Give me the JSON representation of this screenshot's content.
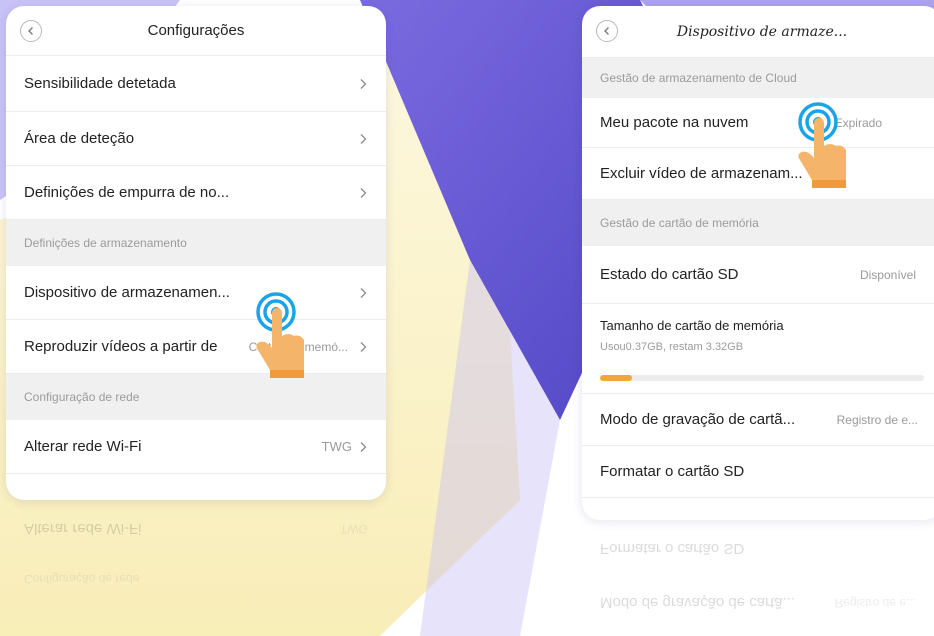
{
  "colors": {
    "accent_progress": "#f2a53a",
    "touch_ring": "#1aa3e8",
    "hand": "#f4b56a",
    "bg_purple": "#6a5ad8",
    "bg_yellow": "#f7e89a"
  },
  "left_screen": {
    "title": "Configurações",
    "back_icon": "chevron-left-icon",
    "rows_top": [
      {
        "label": "Sensibilidade detetada",
        "value": ""
      },
      {
        "label": "Área de deteção",
        "value": ""
      },
      {
        "label": "Definições de empurra de no...",
        "value": ""
      }
    ],
    "section_storage": "Definições de armazenamento",
    "rows_storage": [
      {
        "label": "Dispositivo de armazenamen...",
        "value": ""
      },
      {
        "label": "Reproduzir vídeos a partir de",
        "value": "Cartão de memó..."
      }
    ],
    "section_network": "Configuração de rede",
    "rows_network": [
      {
        "label": "Alterar rede Wi-Fi",
        "value": "TWG"
      }
    ],
    "reflection": {
      "row_label": "Alterar rede Wi-Fi",
      "row_value": "TWG",
      "section": "Configuração de rede"
    }
  },
  "right_screen": {
    "title": "Dispositivo de armaze...",
    "back_icon": "chevron-left-icon",
    "section_cloud": "Gestão de armazenamento de Cloud",
    "rows_cloud": [
      {
        "label": "Meu pacote na nuvem",
        "value": "Expirado"
      },
      {
        "label": "Excluir vídeo de armazenam...",
        "value": ""
      }
    ],
    "section_card": "Gestão de cartão de memória",
    "sd_state": {
      "label": "Estado do cartão SD",
      "value": "Disponível"
    },
    "storage": {
      "title": "Tamanho de cartão de memória",
      "subtitle": "Usou0.37GB, restam 3.32GB",
      "used_fraction": 0.1
    },
    "rows_card": [
      {
        "label": "Modo de gravação de cartã...",
        "value": "Registro de e..."
      },
      {
        "label": "Formatar o cartão SD",
        "value": ""
      }
    ],
    "reflection": {
      "row1": "Formatar o cartão SD",
      "row2": "Modo de gravação de cartã...",
      "row2_value": "Registro de e..."
    }
  }
}
